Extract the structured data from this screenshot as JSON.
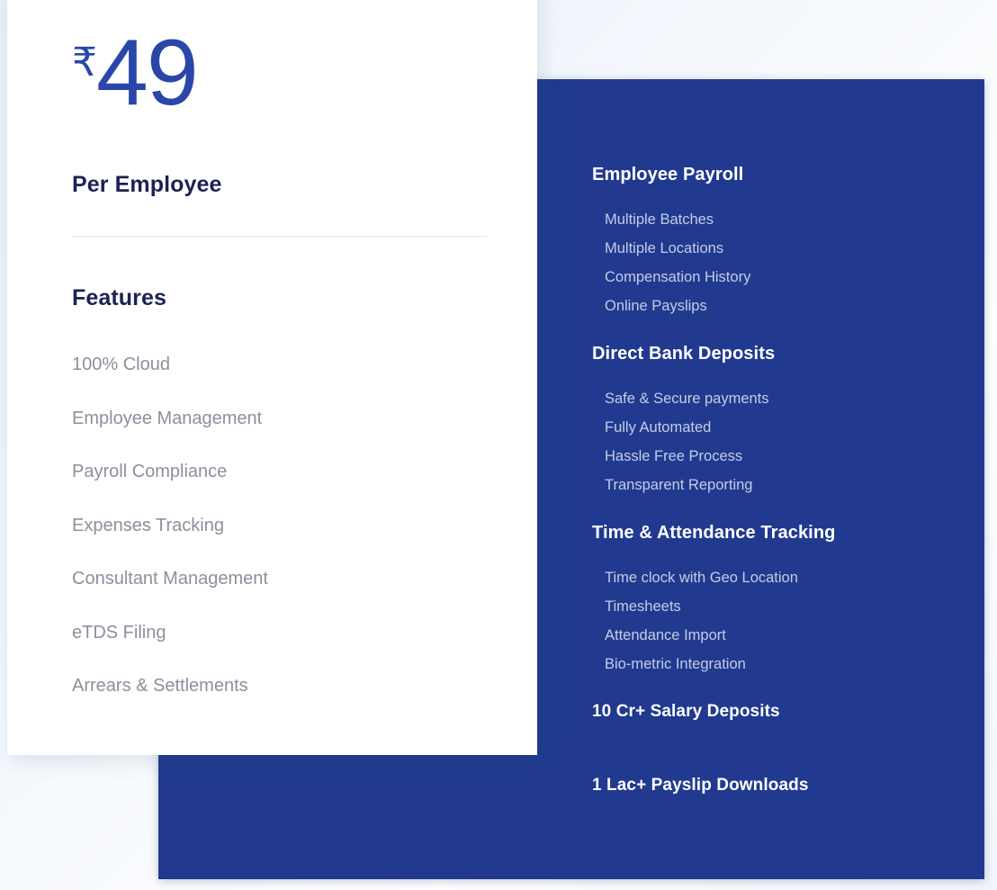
{
  "theme": {
    "page_background": "#eef3fb",
    "card_blue": "#213a8f",
    "card_white": "#ffffff",
    "price_blue": "#2946a8",
    "heading_navy": "#1b2253",
    "feature_gray": "#8b909c",
    "blue_item_text": "#c3cde4"
  },
  "pricing_card": {
    "currency_symbol": "₹",
    "amount": "49",
    "caption": "Per Employee",
    "features_heading": "Features",
    "features": [
      "100% Cloud",
      "Employee Management",
      "Payroll Compliance",
      "Expenses Tracking",
      "Consultant Management",
      "eTDS Filing",
      "Arrears & Settlements"
    ]
  },
  "feature_card": {
    "groups": [
      {
        "heading": "Employee Payroll",
        "items": [
          "Multiple Batches",
          "Multiple Locations",
          "Compensation History",
          "Online Payslips"
        ]
      },
      {
        "heading": "Direct Bank Deposits",
        "items": [
          "Safe & Secure payments",
          "Fully Automated",
          "Hassle Free Process",
          "Transparent Reporting"
        ]
      },
      {
        "heading": "Time & Attendance Tracking",
        "items": [
          "Time clock with Geo Location",
          "Timesheets",
          "Attendance Import",
          "Bio-metric Integration"
        ]
      }
    ],
    "stats": [
      "10 Cr+ Salary Deposits",
      "1 Lac+ Payslip Downloads"
    ]
  }
}
